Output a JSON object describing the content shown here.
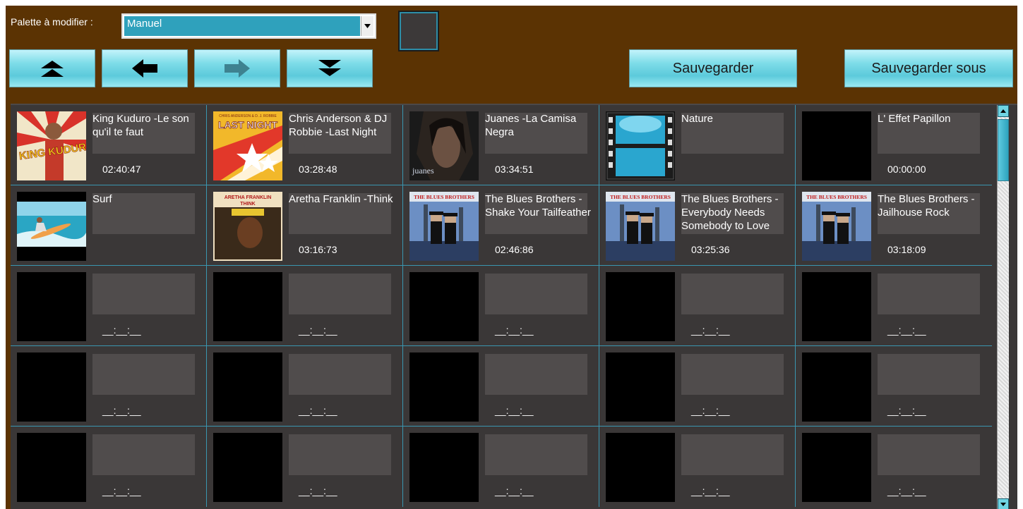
{
  "palette": {
    "label": "Palette à modifier :",
    "selected": "Manuel",
    "dropdown_icon": "chevron-down-icon",
    "color_swatch": "#3c3939"
  },
  "toolbar": {
    "buttons": [
      {
        "icon": "double-chevron-up-icon",
        "enabled": true
      },
      {
        "icon": "arrow-left-icon",
        "enabled": true
      },
      {
        "icon": "arrow-right-icon",
        "enabled": false
      },
      {
        "icon": "double-chevron-down-icon",
        "enabled": true
      }
    ],
    "save_label": "Sauvegarder",
    "save_as_label": "Sauvegarder sous"
  },
  "colors": {
    "background": "#5b3303",
    "grid": "#3a3737",
    "grid_lines": "#3a96b0",
    "accent": "#5ccadb"
  },
  "tracks": [
    {
      "title": "King Kuduro -Le son qu'il te faut",
      "time": "02:40:47",
      "art": "king-kuduro"
    },
    {
      "title": "Chris Anderson & DJ Robbie  -Last Night",
      "time": "03:28:48",
      "art": "last-night"
    },
    {
      "title": "Juanes -La Camisa Negra",
      "time": "03:34:51",
      "art": "juanes"
    },
    {
      "title": "Nature",
      "time": "",
      "art": "film-icon"
    },
    {
      "title": "L' Effet Papillon",
      "time": "00:00:00",
      "art": "empty"
    },
    {
      "title": "Surf",
      "time": "",
      "art": "surf"
    },
    {
      "title": "Aretha Franklin -Think",
      "time": "03:16:73",
      "art": "aretha"
    },
    {
      "title": "The Blues Brothers -Shake Your Tailfeather",
      "time": "02:46:86",
      "art": "blues-brothers"
    },
    {
      "title": "The Blues Brothers -Everybody Needs Somebody to Love",
      "time": "03:25:36",
      "art": "blues-brothers"
    },
    {
      "title": "The Blues Brothers -Jailhouse Rock",
      "time": "03:18:09",
      "art": "blues-brothers"
    }
  ],
  "empty_slot_time": "__:__:__",
  "art_text": {
    "king_kuduro": "KING KUDURO",
    "last_night_top": "CHRIS ANDERSON & D. J. ROBBIE",
    "last_night": "LAST NIGHT",
    "juanes": "juanes",
    "aretha_top": "ARETHA FRANKLIN",
    "aretha_think": "THINK",
    "blues_brothers": "THE BLUES BROTHERS"
  },
  "scrollbar": {
    "up_icon": "triangle-up-icon",
    "down_icon": "triangle-down-icon"
  }
}
